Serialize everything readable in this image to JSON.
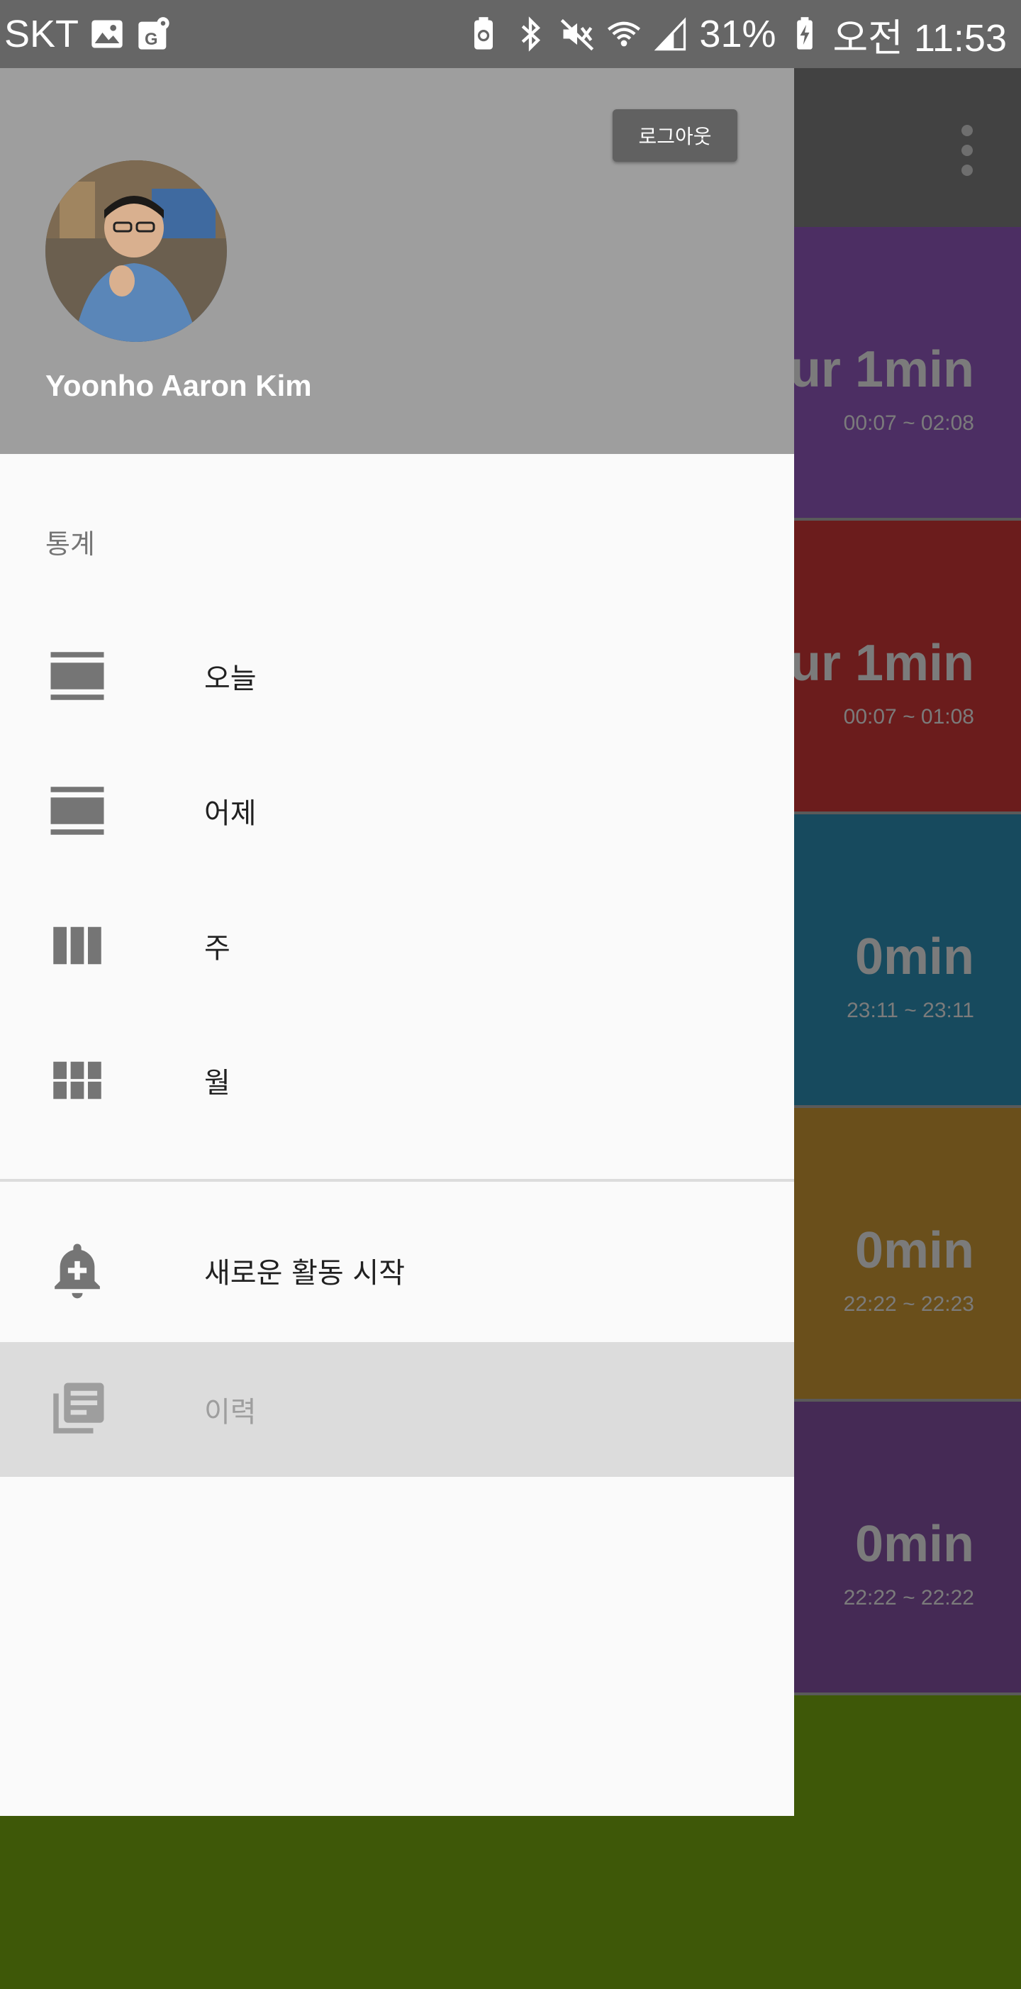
{
  "status_bar": {
    "carrier": "SKT",
    "battery": "31%",
    "time": "오전 11:53",
    "icons_left": [
      "image-icon",
      "maps-icon"
    ],
    "icons_right": [
      "battery-saver-icon",
      "bluetooth-icon",
      "mute-icon",
      "wifi-icon",
      "signal-icon",
      "charging-icon"
    ]
  },
  "drawer": {
    "logout_label": "로그아웃",
    "user_name": "Yoonho Aaron Kim",
    "section_title": "통계",
    "items": [
      {
        "label": "오늘",
        "icon": "view-day-icon"
      },
      {
        "label": "어제",
        "icon": "view-day-icon"
      },
      {
        "label": "주",
        "icon": "view-week-icon"
      },
      {
        "label": "월",
        "icon": "view-module-icon"
      }
    ],
    "actions": [
      {
        "label": "새로운 활동 시작",
        "icon": "add-alert-icon"
      },
      {
        "label": "이력",
        "icon": "history-icon"
      }
    ]
  },
  "background": {
    "cards": [
      {
        "duration": "ur 1min",
        "range": "00:07 ~ 02:08",
        "color": "#4c2e63"
      },
      {
        "duration": "ur 1min",
        "range": "00:07 ~ 01:08",
        "color": "#6b1c1c"
      },
      {
        "duration": "0min",
        "range": "23:11 ~ 23:11",
        "color": "#174a5e"
      },
      {
        "duration": "0min",
        "range": "22:22 ~ 22:23",
        "color": "#6a4f1b"
      },
      {
        "duration": "0min",
        "range": "22:22 ~ 22:22",
        "color": "#452a55"
      },
      {
        "duration": "",
        "range": "",
        "color": "#3e5808"
      }
    ]
  }
}
